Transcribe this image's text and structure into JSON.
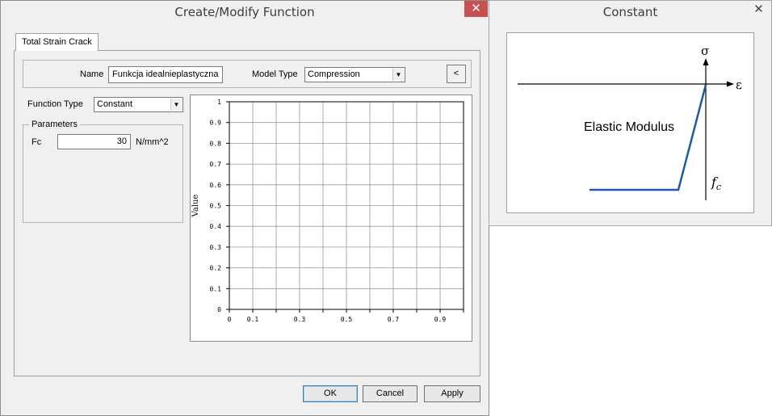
{
  "main_window": {
    "title": "Create/Modify Function",
    "close_glyph": "✕",
    "tab_label": "Total Strain Crack",
    "name_label": "Name",
    "name_value": "Funkcja idealnieplastyczna",
    "model_type_label": "Model Type",
    "model_type_value": "Compression",
    "collapse_button": "<",
    "function_type_label": "Function Type",
    "function_type_value": "Constant",
    "parameters_legend": "Parameters",
    "fc_label": "Fc",
    "fc_value": "30",
    "fc_unit": "N/mm^2",
    "buttons": {
      "ok": "OK",
      "cancel": "Cancel",
      "apply": "Apply"
    }
  },
  "chart_data": {
    "type": "line",
    "ylabel": "Value",
    "xlabel": "",
    "xlim": [
      0,
      1
    ],
    "ylim": [
      0,
      1
    ],
    "x_ticks": [
      "0",
      "0.1",
      "0.3",
      "0.5",
      "0.7",
      "0.9"
    ],
    "x_tick_values": [
      0,
      0.1,
      0.3,
      0.5,
      0.7,
      0.9
    ],
    "y_ticks": [
      "0",
      "0.1",
      "0.2",
      "0.3",
      "0.4",
      "0.5",
      "0.6",
      "0.7",
      "0.8",
      "0.9",
      "1"
    ],
    "y_tick_values": [
      0,
      0.1,
      0.2,
      0.3,
      0.4,
      0.5,
      0.6,
      0.7,
      0.8,
      0.9,
      1
    ],
    "grid": true,
    "series": []
  },
  "constant_window": {
    "title": "Constant",
    "close_glyph": "✕",
    "sigma_label": "σ",
    "epsilon_label": "ε",
    "curve_label": "Elastic Modulus",
    "fc_symbol": "f",
    "fc_subscript": "c",
    "curve_color": "#1f5aa6"
  }
}
